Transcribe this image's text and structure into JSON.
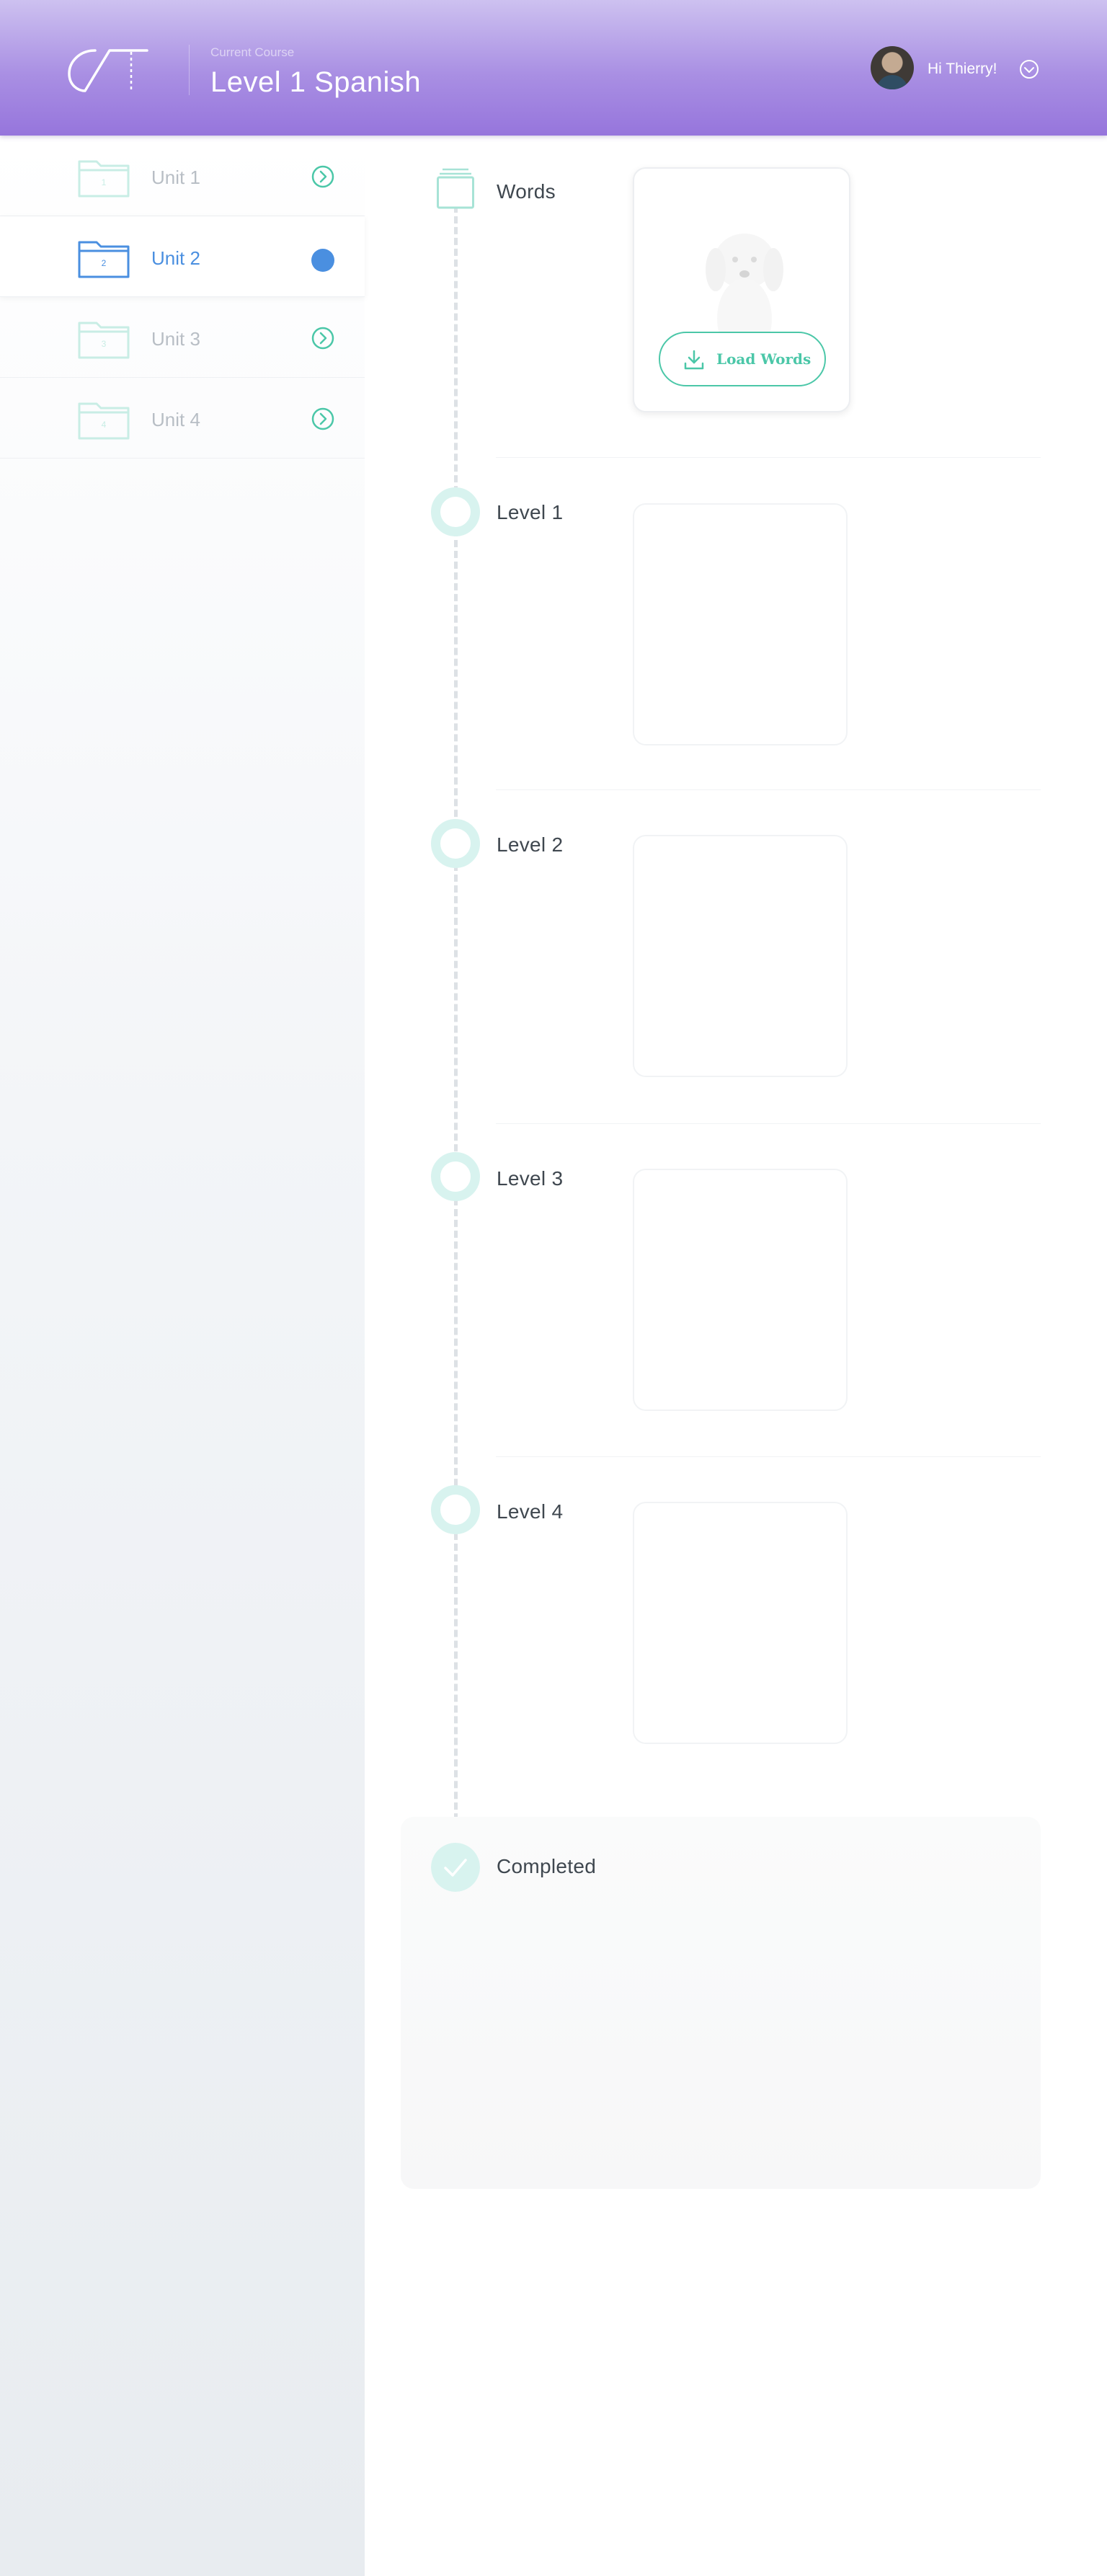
{
  "header": {
    "logo_name": "course-logo",
    "course_caption": "Current Course",
    "course_title": "Level 1 Spanish",
    "greeting": "Hi Thierry!",
    "accent_color": "#9675dc"
  },
  "sidebar": {
    "units": [
      {
        "number": "1",
        "label": "Unit 1",
        "active": false
      },
      {
        "number": "2",
        "label": "Unit 2",
        "active": true
      },
      {
        "number": "3",
        "label": "Unit 3",
        "active": false
      },
      {
        "number": "4",
        "label": "Unit 4",
        "active": false
      }
    ],
    "active_color": "#4a8fe0",
    "inactive_color": "#b8bec5"
  },
  "timeline": {
    "words": {
      "label": "Words",
      "button_label": "Load Words"
    },
    "levels": [
      {
        "label": "Level 1"
      },
      {
        "label": "Level 2"
      },
      {
        "label": "Level 3"
      },
      {
        "label": "Level 4"
      }
    ],
    "completed": {
      "label": "Completed"
    },
    "accent_color": "#4bc7a8"
  }
}
